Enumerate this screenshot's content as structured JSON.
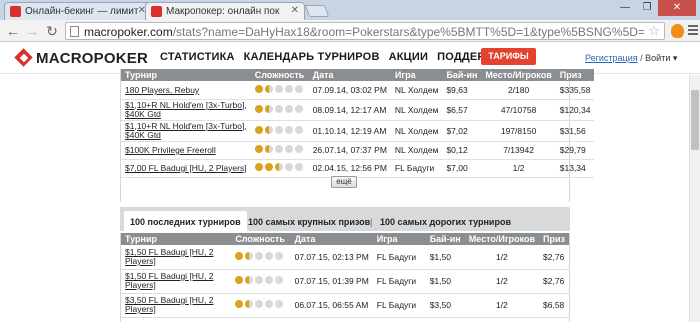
{
  "browser": {
    "tabs": [
      {
        "title": "Онлайн-бекинг — лимит",
        "active": false
      },
      {
        "title": "Макропокер: онлайн пок",
        "active": true
      }
    ],
    "url_host": "macropoker.com",
    "url_rest": "/stats?name=DaHyHax18&room=Pokerstars&type%5BMTT%5D=1&type%5BSNG%5D=1&type%5",
    "window_buttons": [
      "—",
      "❐",
      "✕"
    ]
  },
  "header": {
    "logo": "MACROPOKER",
    "nav": [
      "СТАТИСТИКА",
      "КАЛЕНДАРЬ ТУРНИРОВ",
      "АКЦИИ",
      "ПОДДЕРЖКА"
    ],
    "tariffs_button": "ТАРИФЫ",
    "register": "Регистрация",
    "separator": "/",
    "login": "Войти",
    "login_arrow": "▾"
  },
  "table1": {
    "columns": [
      "Турнир",
      "Сложность",
      "Дата",
      "Игра",
      "Бай-ин",
      "Место/Игроков",
      "Приз"
    ],
    "rows": [
      {
        "name": [
          "180 Players, Rebuy"
        ],
        "stars": 1.5,
        "date": "07.09.14, 03:02 PM",
        "game": "NL Холдем",
        "buyin": "$9,63",
        "place": "2/180",
        "prize": "$335,58"
      },
      {
        "name": [
          "$1,10+R NL Hold'em [3x-Turbo],",
          "$40K Gtd"
        ],
        "stars": 1.5,
        "date": "08.09.14, 12:17 AM",
        "game": "NL Холдем",
        "buyin": "$6,57",
        "place": "47/10758",
        "prize": "$120,34"
      },
      {
        "name": [
          "$1,10+R NL Hold'em [3x-Turbo],",
          "$40K Gtd"
        ],
        "stars": 1.5,
        "date": "01.10.14, 12:19 AM",
        "game": "NL Холдем",
        "buyin": "$7,02",
        "place": "197/8150",
        "prize": "$31,56"
      },
      {
        "name": [
          "$100K Privilege Freeroll"
        ],
        "stars": 1.5,
        "date": "26.07.14, 07:37 PM",
        "game": "NL Холдем",
        "buyin": "$0,12",
        "place": "7/13942",
        "prize": "$29,79"
      },
      {
        "name": [
          "$7,00 FL Badugi [HU, 2 Players]"
        ],
        "stars": 2.5,
        "date": "02.04.15, 12:56 PM",
        "game": "FL Бадуги",
        "buyin": "$7,00",
        "place": "1/2",
        "prize": "$13,34"
      }
    ],
    "more_button": "ещё"
  },
  "tabs2": {
    "items": [
      "100 последних турниров",
      "100 самых крупных призов",
      "100 самых дорогих турниров"
    ],
    "separator": "|"
  },
  "table2": {
    "columns": [
      "Турнир",
      "Сложность",
      "Дата",
      "Игра",
      "Бай-ин",
      "Место/Игроков",
      "Приз"
    ],
    "rows": [
      {
        "name": [
          "$1,50 FL Badugi [HU, 2",
          "Players]"
        ],
        "stars": 1.5,
        "date": "07.07.15, 02:13 PM",
        "game": "FL Бадуги",
        "buyin": "$1,50",
        "place": "1/2",
        "prize": "$2,76"
      },
      {
        "name": [
          "$1,50 FL Badugi [HU, 2",
          "Players]"
        ],
        "stars": 1.5,
        "date": "07.07.15, 01:39 PM",
        "game": "FL Бадуги",
        "buyin": "$1,50",
        "place": "1/2",
        "prize": "$2,76"
      },
      {
        "name": [
          "$3,50 FL Badugi [HU, 2",
          "Players]"
        ],
        "stars": 1.5,
        "date": "06.07.15, 06:55 AM",
        "game": "FL Бадуги",
        "buyin": "$3,50",
        "place": "1/2",
        "prize": "$6,58"
      }
    ]
  },
  "colors": {
    "brand_red": "#d9302b",
    "header_gray": "#8a8e91",
    "star_gold": "#d9a21c"
  }
}
